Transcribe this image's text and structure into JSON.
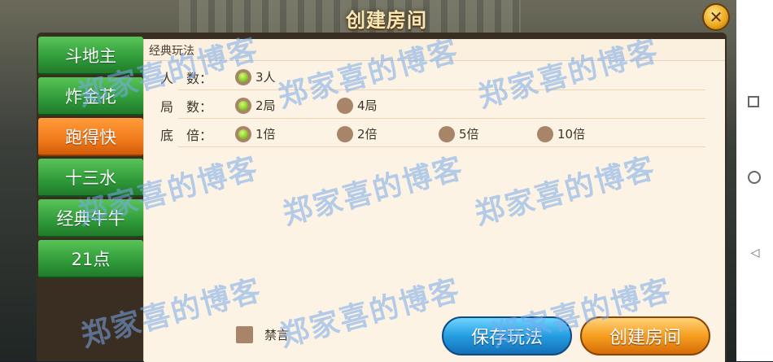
{
  "dialog": {
    "title": "创建房间",
    "close_icon": "close-x-icon"
  },
  "sidebar": {
    "tabs": [
      {
        "label": "斗地主",
        "active": false
      },
      {
        "label": "炸金花",
        "active": false
      },
      {
        "label": "跑得快",
        "active": true
      },
      {
        "label": "十三水",
        "active": false
      },
      {
        "label": "经典牛牛",
        "active": false
      },
      {
        "label": "21点",
        "active": false
      }
    ]
  },
  "panel": {
    "section_label": "经典玩法",
    "rows": [
      {
        "label": "人　数：",
        "options": [
          {
            "text": "3人",
            "selected": true
          }
        ]
      },
      {
        "label": "局　数：",
        "options": [
          {
            "text": "2局",
            "selected": true
          },
          {
            "text": "4局",
            "selected": false
          }
        ]
      },
      {
        "label": "底　倍：",
        "options": [
          {
            "text": "1倍",
            "selected": true
          },
          {
            "text": "2倍",
            "selected": false
          },
          {
            "text": "5倍",
            "selected": false
          },
          {
            "text": "10倍",
            "selected": false
          }
        ]
      }
    ],
    "mute_label": "禁言",
    "mute_checked": false
  },
  "buttons": {
    "save": "保存玩法",
    "create": "创建房间"
  },
  "watermark": "郑家喜的博客",
  "colors": {
    "tab_green": "#2f9a39",
    "tab_active": "#f07a1a",
    "save_blue": "#249de0",
    "create_orange": "#f79e1f"
  }
}
